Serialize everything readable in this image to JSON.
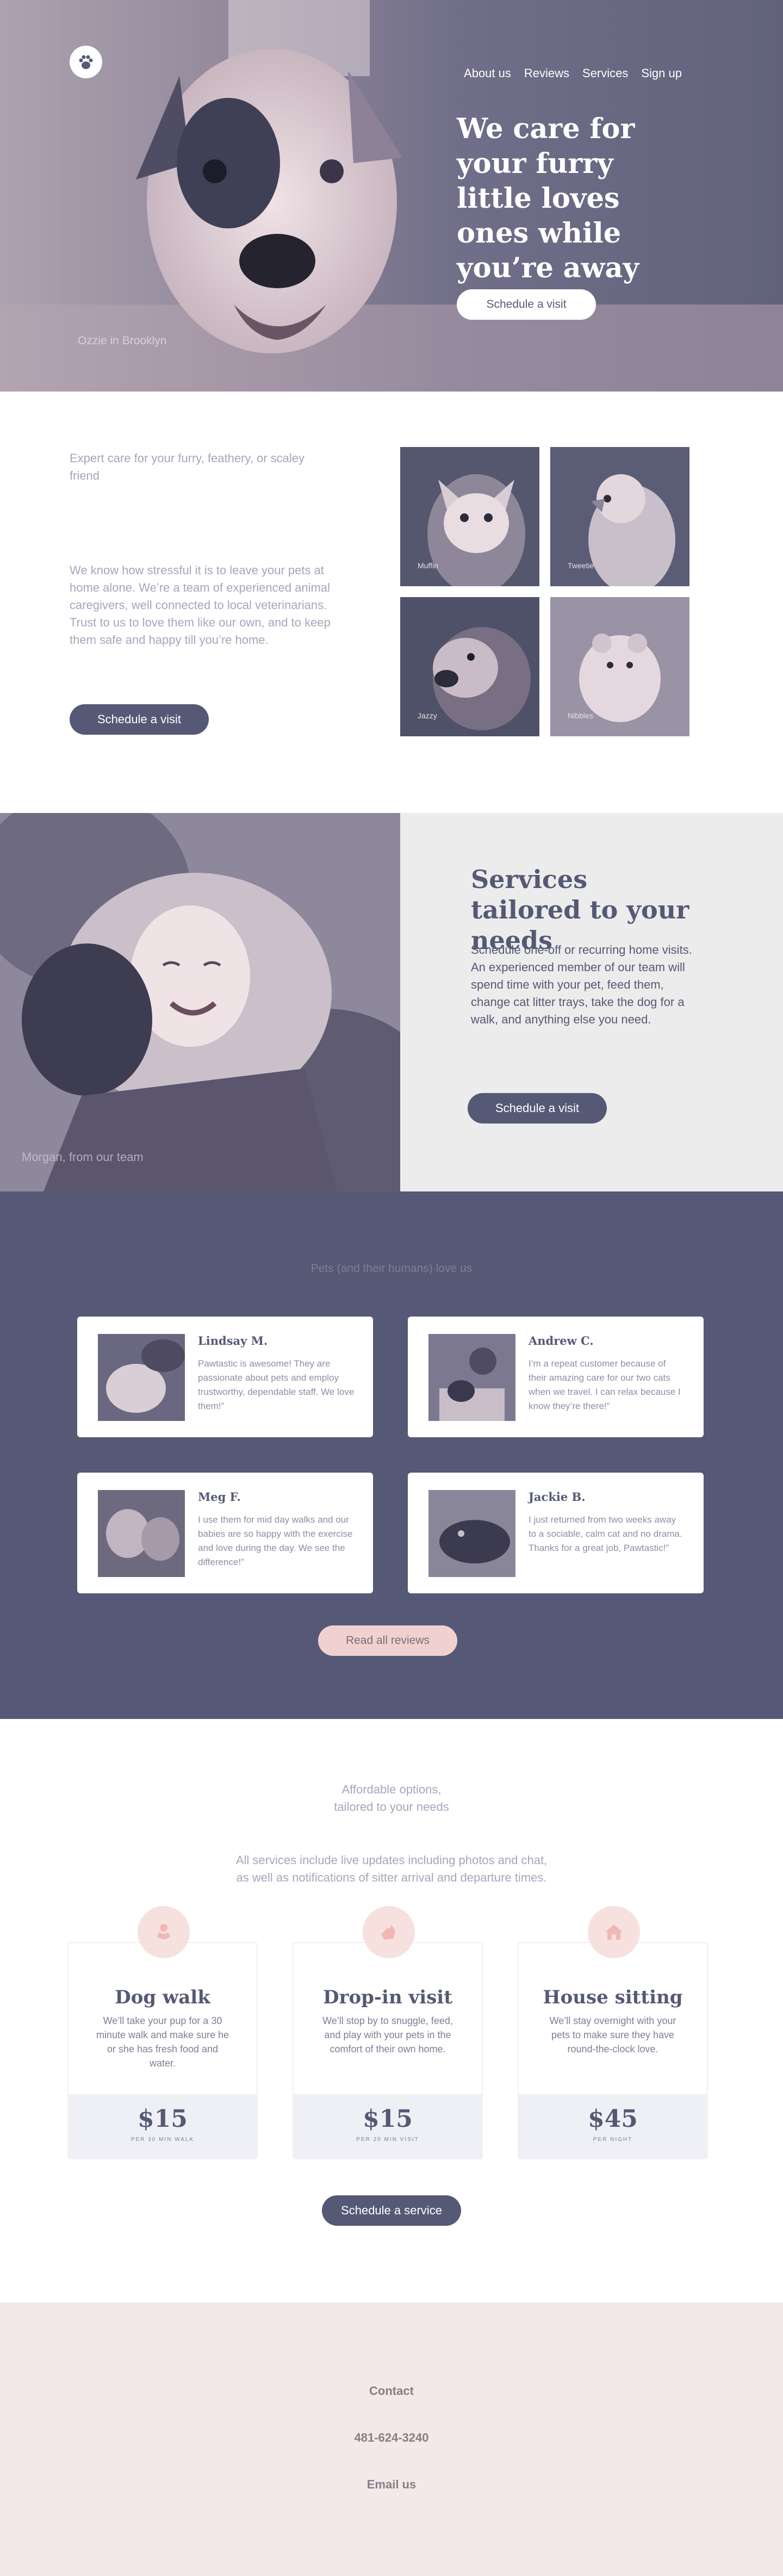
{
  "nav": {
    "items": [
      "About us",
      "Reviews",
      "Services",
      "Sign up"
    ]
  },
  "hero": {
    "headline": "We care for your furry little loves ones while you’re away",
    "cta": "Schedule a visit",
    "caption": "Ozzie in Brooklyn"
  },
  "about": {
    "tagline": "Expert care for your furry, feathery, or scaley friend",
    "body": "We know how stressful it is to leave your pets at home alone. We’re a team of experienced animal caregivers, well connected to local veterinarians. Trust to us to love them like our own, and to keep them safe and happy till you’re home.",
    "cta": "Schedule a visit",
    "pets": [
      "Muffin",
      "Tweetie",
      "Jazzy",
      "Nibbles"
    ]
  },
  "services": {
    "title": "Services tailored to your needs",
    "body": "Schedule one-off or recurring home visits. An experienced member of our team will spend time with your pet, feed them, change cat litter trays, take the dog for a walk, and anything else you need.",
    "cta": "Schedule a visit",
    "caption": "Morgan, from our team"
  },
  "reviews": {
    "heading": "Pets (and their humans) love us",
    "items": [
      {
        "name": "Lindsay M.",
        "text": "Pawtastic is awesome! They are passionate about pets and employ trustworthy, dependable staff. We love them!”"
      },
      {
        "name": "Andrew C.",
        "text": "I’m a repeat customer because of their amazing care for our two cats when we travel. I can relax because I know they’re there!”"
      },
      {
        "name": "Meg F.",
        "text": "I use them for mid day walks and our babies are so happy with the exercise and love during the day. We see the difference!”"
      },
      {
        "name": "Jackie B.",
        "text": "I just returned from two weeks away to a sociable, calm cat and no drama. Thanks for a great job, Pawtastic!”"
      }
    ],
    "cta": "Read all reviews"
  },
  "pricing": {
    "heading_line1": "Affordable options,",
    "heading_line2": "tailored to your needs",
    "sub_line1": "All services include live updates including photos and chat,",
    "sub_line2": "as well as notifications of sitter arrival and departure times.",
    "plans": [
      {
        "icon": "dog-hand-icon",
        "title": "Dog walk",
        "desc": "We’ll take your pup for a 30 minute walk and make sure he or she has fresh food and water.",
        "price": "$15",
        "unit": "PER 30 MIN WALK"
      },
      {
        "icon": "cat-hand-icon",
        "title": "Drop-in visit",
        "desc": "We’ll stop by to snuggle, feed, and play with your pets in the comfort of their own home.",
        "price": "$15",
        "unit": "PER 20 MIN VISIT"
      },
      {
        "icon": "house-icon",
        "title": "House sitting",
        "desc": "We’ll stay overnight with your pets to make sure they have round-the-clock love.",
        "price": "$45",
        "unit": "PER NIGHT"
      }
    ],
    "cta": "Schedule a service"
  },
  "footer": {
    "contact": "Contact",
    "phone": "481-624-3240",
    "email": "Email us"
  },
  "colors": {
    "primary": "#555975",
    "pink": "#f1d1cf",
    "footer_bg": "#f5e8e9"
  }
}
